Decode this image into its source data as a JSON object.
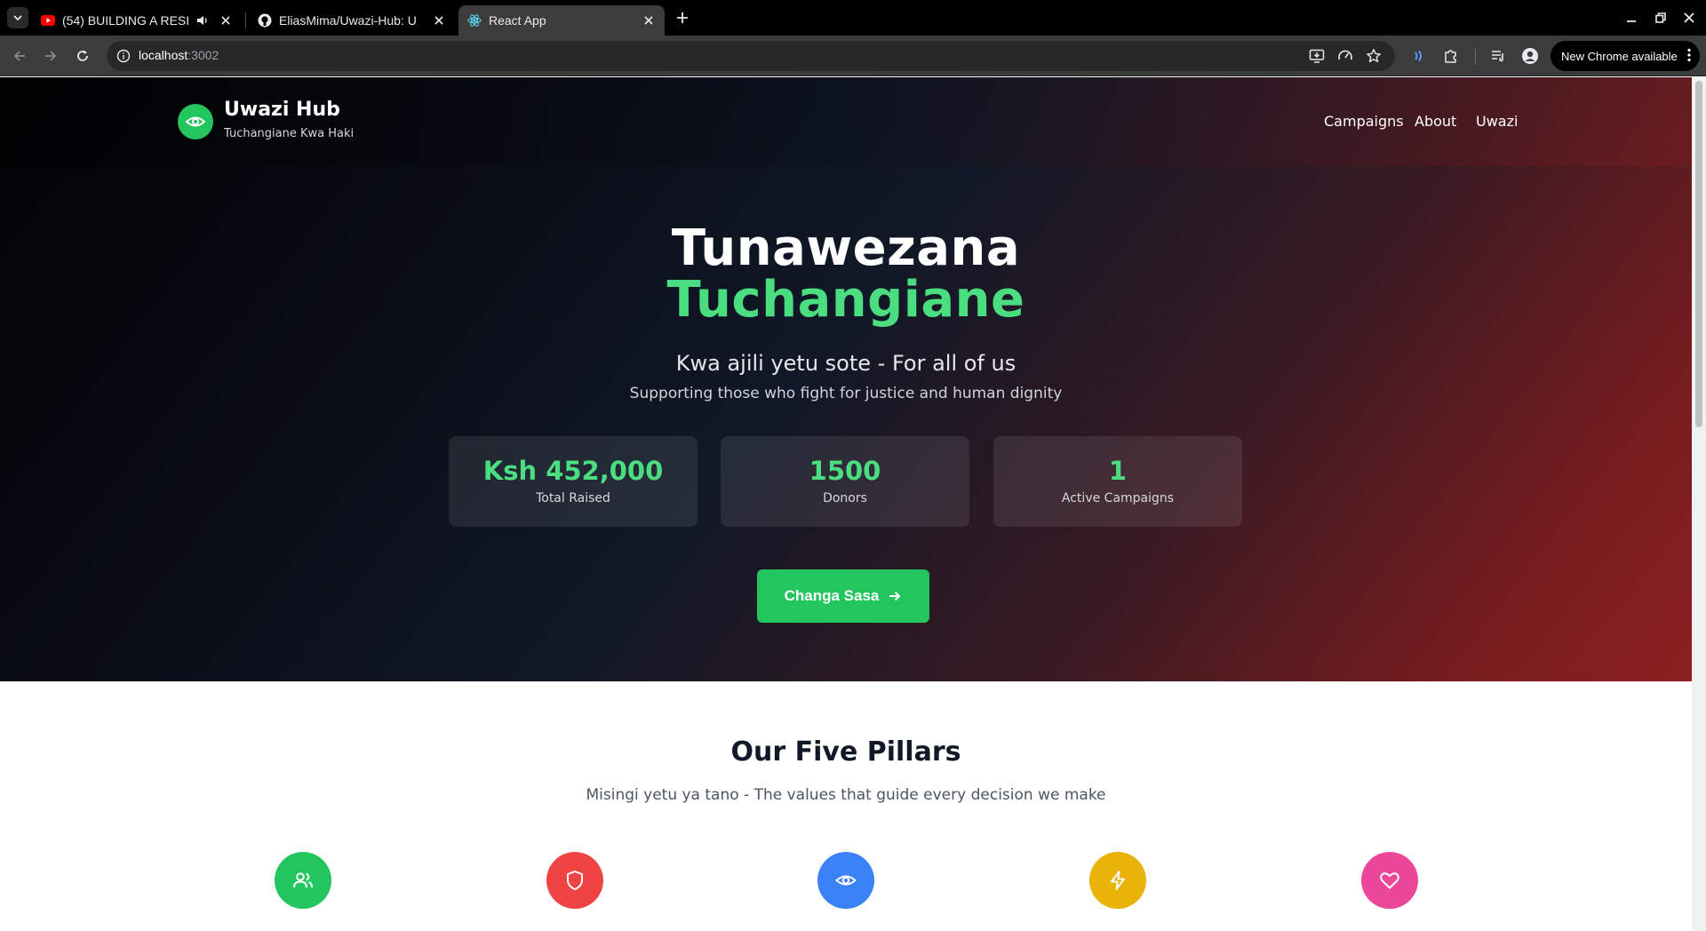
{
  "browser": {
    "tabs": [
      {
        "title": "(54) BUILDING A RESI",
        "favicon": "youtube-icon",
        "audio": "speaker-icon"
      },
      {
        "title": "EliasMima/Uwazi-Hub: U",
        "favicon": "github-icon"
      },
      {
        "title": "React App",
        "favicon": "react-icon",
        "active": true
      }
    ],
    "url_host": "localhost",
    "url_port": ":3002",
    "update_label": "New Chrome available"
  },
  "site": {
    "brand_name": "Uwazi Hub",
    "brand_tagline": "Tuchangiane Kwa Haki",
    "nav": [
      "Campaigns",
      "About",
      "Uwazi"
    ]
  },
  "hero": {
    "title_line1": "Tunawezana",
    "title_line2": "Tuchangiane",
    "subtitle": "Kwa ajili yetu sote - For all of us",
    "tagline": "Supporting those who fight for justice and human dignity",
    "stats": [
      {
        "value": "Ksh 452,000",
        "label": "Total Raised"
      },
      {
        "value": "1500",
        "label": "Donors"
      },
      {
        "value": "1",
        "label": "Active Campaigns"
      }
    ],
    "cta_label": "Changa Sasa"
  },
  "pillars": {
    "title": "Our Five Pillars",
    "subtitle": "Misingi yetu ya tano - The values that guide every decision we make",
    "items": [
      {
        "icon": "users-icon",
        "color": "#22c55e"
      },
      {
        "icon": "shield-icon",
        "color": "#ef4444"
      },
      {
        "icon": "eye-icon",
        "color": "#3b82f6"
      },
      {
        "icon": "lightning-icon",
        "color": "#eab308"
      },
      {
        "icon": "heart-icon",
        "color": "#ec4899"
      }
    ]
  },
  "colors": {
    "accent_green": "#22c55e",
    "hero_green_text": "#4ade80",
    "hero_dark": "#111827",
    "hero_red": "#8c1f1f"
  }
}
